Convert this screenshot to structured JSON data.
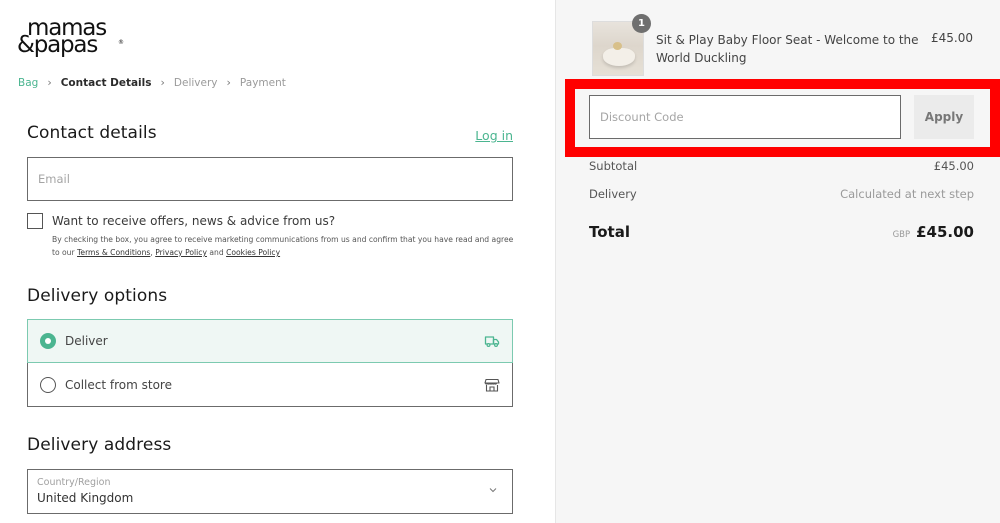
{
  "brand": {
    "logo_line1": "mamas",
    "logo_line2": "&papas",
    "logo_reg": "®"
  },
  "breadcrumb": {
    "items": [
      {
        "label": "Bag",
        "state": "link"
      },
      {
        "label": "Contact Details",
        "state": "current"
      },
      {
        "label": "Delivery",
        "state": "upcoming"
      },
      {
        "label": "Payment",
        "state": "upcoming"
      }
    ],
    "separator": "›"
  },
  "contact": {
    "title": "Contact details",
    "login_label": "Log in",
    "email_placeholder": "Email",
    "email_value": "",
    "marketing_optin": {
      "checked": false,
      "label": "Want to receive offers, news & advice from us?",
      "fine_print_prefix": "By checking the box, you agree to receive marketing communications from us and confirm that you have read and agree to our ",
      "terms_label": "Terms & Conditions",
      "comma": ", ",
      "privacy_label": "Privacy Policy",
      "and": " and ",
      "cookies_label": "Cookies Policy"
    }
  },
  "delivery_options": {
    "title": "Delivery options",
    "options": [
      {
        "label": "Deliver",
        "selected": true,
        "icon": "truck-icon"
      },
      {
        "label": "Collect from store",
        "selected": false,
        "icon": "store-icon"
      }
    ]
  },
  "delivery_address": {
    "title": "Delivery address",
    "country_label": "Country/Region",
    "country_value": "United Kingdom"
  },
  "order_summary": {
    "item": {
      "quantity": "1",
      "name": "Sit & Play Baby Floor Seat - Welcome to the World Duckling",
      "price": "£45.00"
    },
    "discount": {
      "placeholder": "Discount Code",
      "value": "",
      "apply_label": "Apply"
    },
    "subtotal_label": "Subtotal",
    "subtotal_value": "£45.00",
    "delivery_label": "Delivery",
    "delivery_value": "Calculated at next step",
    "total_label": "Total",
    "total_currency": "GBP",
    "total_value": "£45.00"
  },
  "colors": {
    "accent": "#4bb590",
    "highlight": "#ff0000",
    "summary_bg": "#f6f6f6"
  }
}
